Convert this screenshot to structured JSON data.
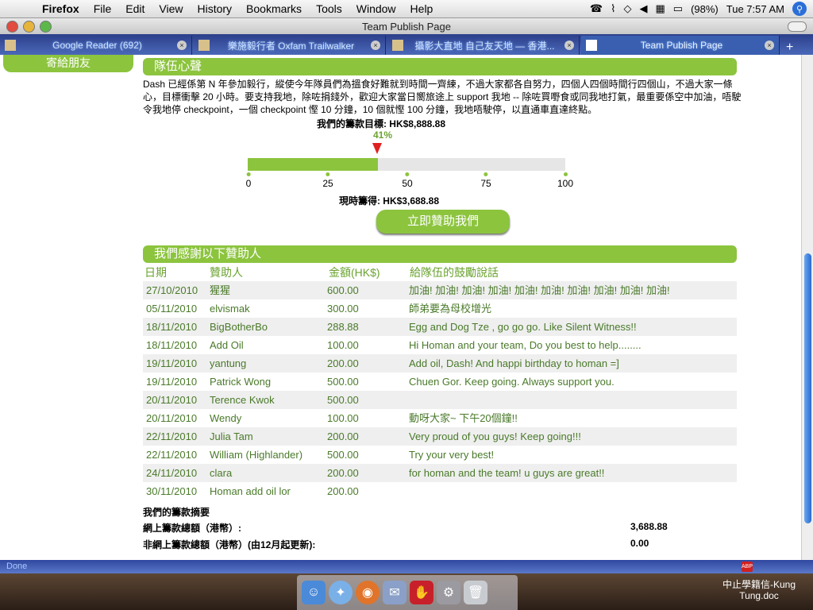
{
  "menubar": {
    "apple_glyph": "",
    "app": "Firefox",
    "items": [
      "File",
      "Edit",
      "View",
      "History",
      "Bookmarks",
      "Tools",
      "Window",
      "Help"
    ],
    "battery": "(98%)",
    "clock": "Tue 7:57 AM"
  },
  "window": {
    "title": "Team Publish Page"
  },
  "tabs": [
    {
      "label": "Google Reader (692)"
    },
    {
      "label": "樂施毅行者 Oxfam Trailwalker"
    },
    {
      "label": "攝影大直地 自己友天地 — 香港..."
    },
    {
      "label": "Team Publish Page"
    }
  ],
  "page": {
    "side_button": "寄給朋友",
    "section1_title": "隊伍心聲",
    "intro": "Dash 已經係第 N 年參加毅行，縱使今年隊員們為搵食好難就到時間一齊練，不過大家都各自努力，四個人四個時間行四個山，不過大家一條心，目標衝擊 20 小時。要支持我地，除咗捐錢外，歡迎大家當日嚮旅途上 support 我地 -- 除咗買嘢食或同我地打氣，最重要係空中加油，唔駛令我地停 checkpoint，一個 checkpoint 慳 10 分鐘，10 個就慳 100 分鐘，我地唔駛停，以直通車直達終點。",
    "goal_label": "我們的籌款目標: HK$8,888.88",
    "progress": {
      "percent_label": "41%",
      "fraction": 0.41,
      "ticks": [
        "0",
        "25",
        "50",
        "75",
        "100"
      ]
    },
    "raised_label": "現時籌得: HK$3,688.88",
    "cta": "立即贊助我們",
    "section2_title": "我們感謝以下贊助人",
    "columns": [
      "日期",
      "贊助人",
      "金額(HK$)",
      "給隊伍的鼓勵說話"
    ],
    "sponsors": [
      {
        "date": "27/10/2010",
        "name": "猩猩",
        "amount": "600.00",
        "message": "加油! 加油! 加油! 加油! 加油! 加油! 加油! 加油! 加油! 加油!"
      },
      {
        "date": "05/11/2010",
        "name": "elvismak",
        "amount": "300.00",
        "message": "師弟要為母校增光"
      },
      {
        "date": "18/11/2010",
        "name": "BigBotherBo",
        "amount": "288.88",
        "message": "Egg and Dog Tze , go go go. Like Silent Witness!!"
      },
      {
        "date": "18/11/2010",
        "name": "Add Oil",
        "amount": "100.00",
        "message": "Hi Homan and your team, Do you best to help........"
      },
      {
        "date": "19/11/2010",
        "name": "yantung",
        "amount": "200.00",
        "message": "Add oil, Dash! And happi birthday to homan =]"
      },
      {
        "date": "19/11/2010",
        "name": "Patrick Wong",
        "amount": "500.00",
        "message": "Chuen Gor. Keep going. Always support you."
      },
      {
        "date": "20/11/2010",
        "name": "Terence Kwok",
        "amount": "500.00",
        "message": ""
      },
      {
        "date": "20/11/2010",
        "name": "Wendy",
        "amount": "100.00",
        "message": "動呀大家~ 下午20個鐘!!"
      },
      {
        "date": "22/11/2010",
        "name": "Julia Tam",
        "amount": "200.00",
        "message": "Very proud of you guys! Keep going!!!"
      },
      {
        "date": "22/11/2010",
        "name": "William (Highlander)",
        "amount": "500.00",
        "message": "Try your very best!"
      },
      {
        "date": "24/11/2010",
        "name": "clara",
        "amount": "200.00",
        "message": "for homan and the team! u guys are great!!"
      },
      {
        "date": "30/11/2010",
        "name": "Homan add oil lor",
        "amount": "200.00",
        "message": ""
      }
    ],
    "summary": {
      "title": "我們的籌款摘要",
      "online_label": "網上籌款總額（港幣）:",
      "online_value": "3,688.88",
      "offline_label": "非網上籌款總額（港幣）(由12月起更新):",
      "offline_value": "0.00"
    }
  },
  "statusbar": {
    "text": "Done",
    "abp": "ABP"
  },
  "desktop": {
    "file_label": "中止學籍信-Kung Tung.doc"
  },
  "colors": {
    "accent_green": "#8cc43e",
    "marker_red": "#e02020",
    "tab_blue": "#3a5fb0"
  }
}
